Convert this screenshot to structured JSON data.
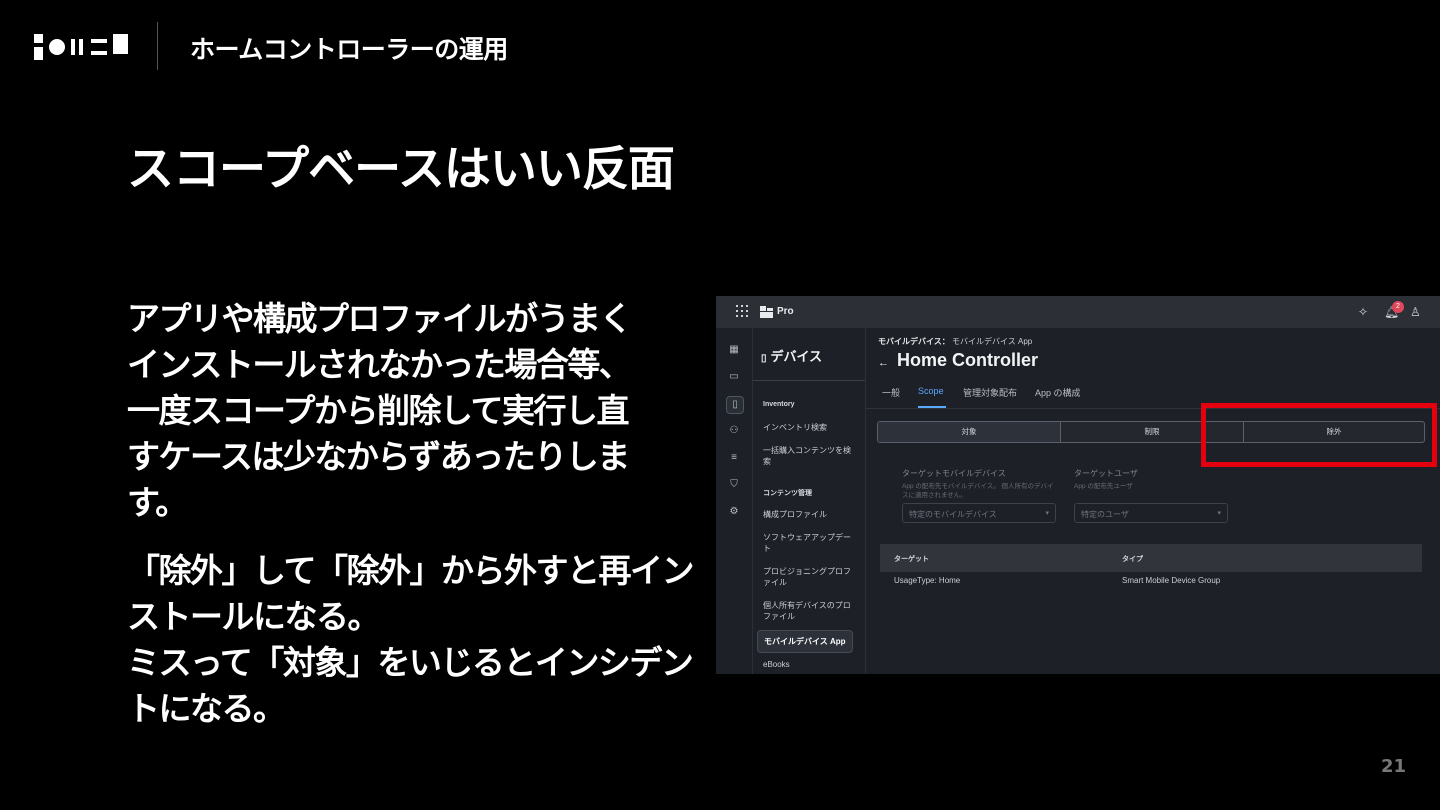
{
  "header": {
    "title": "ホームコントローラーの運用"
  },
  "slide": {
    "title": "スコープベースはいい反面",
    "para1_lines": [
      "アプリや構成プロファイルがうまく",
      "インストールされなかった場合等、",
      "一度スコープから削除して実行し直",
      "すケースは少なからずあったりしま",
      "す。"
    ],
    "para2_lines": [
      "「除外」して「除外」から外すと再イン",
      "ストールになる。",
      "ミスって「対象」をいじるとインシデン",
      "トになる。"
    ],
    "page_number": "21"
  },
  "screenshot": {
    "app_name": "Pro",
    "notification_count": "2",
    "sidebar": {
      "title": "デバイス",
      "sections": [
        {
          "label": "Inventory",
          "items": [
            "インベントリ検索",
            "一括購入コンテンツを検索"
          ]
        },
        {
          "label": "コンテンツ管理",
          "items": [
            "構成プロファイル",
            "ソフトウェアアップデート",
            "プロビジョニングプロファイル",
            "個人所有デバイスのプロファイル",
            "モバイルデバイス App",
            "eBooks"
          ]
        }
      ]
    },
    "breadcrumb": {
      "parent": "モバイルデバイス：",
      "current": "モバイルデバイス App"
    },
    "page_title": "Home Controller",
    "tabs": [
      "一般",
      "Scope",
      "管理対象配布",
      "App の構成"
    ],
    "active_tab": "Scope",
    "segments": [
      "対象",
      "制限",
      "除外"
    ],
    "selected_segment": "対象",
    "fields": [
      {
        "label": "ターゲットモバイルデバイス",
        "help": "App の配布先モバイルデバイス。 個人所有のデバイスに適用されません。",
        "value": "特定のモバイルデバイス"
      },
      {
        "label": "ターゲットユーザ",
        "help": "App の配布先ユーザ",
        "value": "特定のユーザ"
      }
    ],
    "table": {
      "columns": [
        "ターゲット",
        "タイプ"
      ],
      "rows": [
        [
          "UsageType: Home",
          "Smart Mobile Device Group"
        ]
      ]
    }
  },
  "colors": {
    "highlight": "#e4000f",
    "accent": "#5aa8ff",
    "badge": "#e0475a"
  }
}
